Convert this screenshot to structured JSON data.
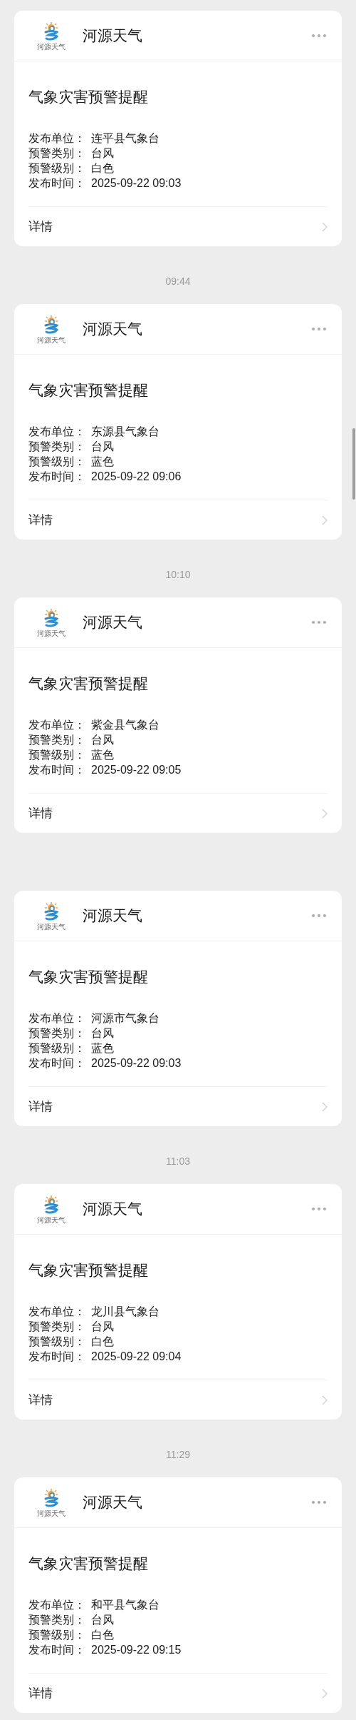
{
  "messages": [
    {
      "sender": "河源天气",
      "logo_caption": "河源天气",
      "title": "气象灾害预警提醒",
      "fields": [
        {
          "label": "发布单位：",
          "value": "连平县气象台"
        },
        {
          "label": "预警类别：",
          "value": "台风"
        },
        {
          "label": "预警级别：",
          "value": "白色"
        },
        {
          "label": "发布时间：",
          "value": "2025-09-22 09:03"
        }
      ],
      "link": "详情"
    },
    {
      "time": "09:44",
      "sender": "河源天气",
      "logo_caption": "河源天气",
      "title": "气象灾害预警提醒",
      "fields": [
        {
          "label": "发布单位：",
          "value": "东源县气象台"
        },
        {
          "label": "预警类别：",
          "value": "台风"
        },
        {
          "label": "预警级别：",
          "value": "蓝色"
        },
        {
          "label": "发布时间：",
          "value": "2025-09-22 09:06"
        }
      ],
      "link": "详情"
    },
    {
      "time": "10:10",
      "sender": "河源天气",
      "logo_caption": "河源天气",
      "title": "气象灾害预警提醒",
      "fields": [
        {
          "label": "发布单位：",
          "value": "紫金县气象台"
        },
        {
          "label": "预警类别：",
          "value": "台风"
        },
        {
          "label": "预警级别：",
          "value": "蓝色"
        },
        {
          "label": "发布时间：",
          "value": "2025-09-22 09:05"
        }
      ],
      "link": "详情"
    },
    {
      "sender": "河源天气",
      "logo_caption": "河源天气",
      "title": "气象灾害预警提醒",
      "fields": [
        {
          "label": "发布单位：",
          "value": "河源市气象台"
        },
        {
          "label": "预警类别：",
          "value": "台风"
        },
        {
          "label": "预警级别：",
          "value": "蓝色"
        },
        {
          "label": "发布时间：",
          "value": "2025-09-22 09:03"
        }
      ],
      "link": "详情"
    },
    {
      "time": "11:03",
      "sender": "河源天气",
      "logo_caption": "河源天气",
      "title": "气象灾害预警提醒",
      "fields": [
        {
          "label": "发布单位：",
          "value": "龙川县气象台"
        },
        {
          "label": "预警类别：",
          "value": "台风"
        },
        {
          "label": "预警级别：",
          "value": "白色"
        },
        {
          "label": "发布时间：",
          "value": "2025-09-22 09:04"
        }
      ],
      "link": "详情"
    },
    {
      "time": "11:29",
      "sender": "河源天气",
      "logo_caption": "河源天气",
      "title": "气象灾害预警提醒",
      "fields": [
        {
          "label": "发布单位：",
          "value": "和平县气象台"
        },
        {
          "label": "预警类别：",
          "value": "台风"
        },
        {
          "label": "预警级别：",
          "value": "白色"
        },
        {
          "label": "发布时间：",
          "value": "2025-09-22 09:15"
        }
      ],
      "link": "详情"
    }
  ]
}
